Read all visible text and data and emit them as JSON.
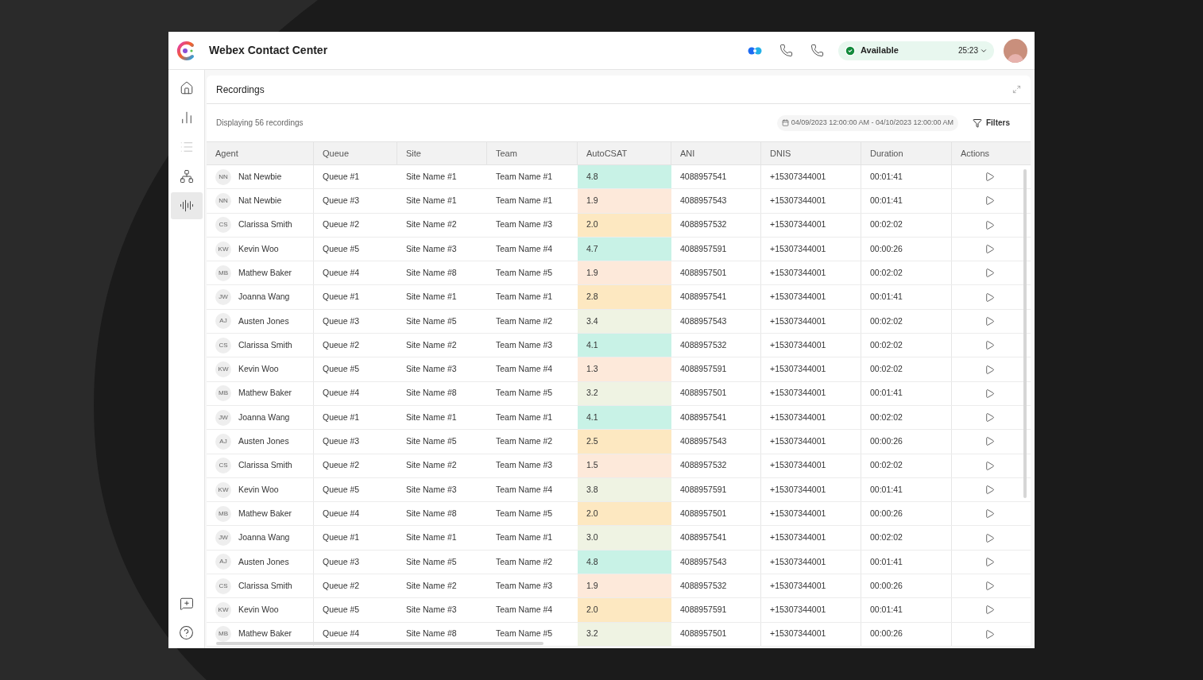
{
  "header": {
    "title": "Webex Contact Center",
    "status": {
      "label": "Available",
      "timer": "25:23"
    }
  },
  "sidebar": {
    "items": [
      {
        "selected": false,
        "disabled": false
      },
      {
        "selected": false,
        "disabled": false
      },
      {
        "selected": false,
        "disabled": true
      },
      {
        "selected": false,
        "disabled": false
      },
      {
        "selected": true,
        "disabled": false
      }
    ]
  },
  "panel": {
    "title": "Recordings",
    "summary": "Displaying 56 recordings",
    "date_range": "04/09/2023 12:00:00 AM - 04/10/2023 12:00:00 AM",
    "filters": "Filters"
  },
  "table": {
    "columns": [
      "Agent",
      "Queue",
      "Site",
      "Team",
      "AutoCSAT",
      "ANI",
      "DNIS",
      "Duration",
      "Actions"
    ],
    "rows": [
      {
        "initials": "NN",
        "agent": "Nat Newbie",
        "queue": "Queue #1",
        "site": "Site Name #1",
        "team": "Team Name #1",
        "autocsat": "4.8",
        "color": "#c8f2e6",
        "ani": "4088957541",
        "dnis": "+15307344001",
        "duration": "00:01:41"
      },
      {
        "initials": "NN",
        "agent": "Nat Newbie",
        "queue": "Queue #3",
        "site": "Site Name #1",
        "team": "Team Name #1",
        "autocsat": "1.9",
        "color": "#fde9da",
        "ani": "4088957543",
        "dnis": "+15307344001",
        "duration": "00:01:41"
      },
      {
        "initials": "CS",
        "agent": "Clarissa Smith",
        "queue": "Queue #2",
        "site": "Site Name #2",
        "team": "Team Name #3",
        "autocsat": "2.0",
        "color": "#fde8c1",
        "ani": "4088957532",
        "dnis": "+15307344001",
        "duration": "00:02:02"
      },
      {
        "initials": "KW",
        "agent": "Kevin Woo",
        "queue": "Queue #5",
        "site": "Site Name #3",
        "team": "Team Name #4",
        "autocsat": "4.7",
        "color": "#c8f2e6",
        "ani": "4088957591",
        "dnis": "+15307344001",
        "duration": "00:00:26"
      },
      {
        "initials": "MB",
        "agent": "Mathew Baker",
        "queue": "Queue #4",
        "site": "Site Name #8",
        "team": "Team Name #5",
        "autocsat": "1.9",
        "color": "#fde9da",
        "ani": "4088957501",
        "dnis": "+15307344001",
        "duration": "00:02:02"
      },
      {
        "initials": "JW",
        "agent": "Joanna Wang",
        "queue": "Queue #1",
        "site": "Site Name #1",
        "team": "Team Name #1",
        "autocsat": "2.8",
        "color": "#fde8c1",
        "ani": "4088957541",
        "dnis": "+15307344001",
        "duration": "00:01:41"
      },
      {
        "initials": "AJ",
        "agent": "Austen Jones",
        "queue": "Queue #3",
        "site": "Site Name #5",
        "team": "Team Name #2",
        "autocsat": "3.4",
        "color": "#eff3e3",
        "ani": "4088957543",
        "dnis": "+15307344001",
        "duration": "00:02:02"
      },
      {
        "initials": "CS",
        "agent": "Clarissa Smith",
        "queue": "Queue #2",
        "site": "Site Name #2",
        "team": "Team Name #3",
        "autocsat": "4.1",
        "color": "#c8f2e6",
        "ani": "4088957532",
        "dnis": "+15307344001",
        "duration": "00:02:02"
      },
      {
        "initials": "KW",
        "agent": "Kevin Woo",
        "queue": "Queue #5",
        "site": "Site Name #3",
        "team": "Team Name #4",
        "autocsat": "1.3",
        "color": "#fde9da",
        "ani": "4088957591",
        "dnis": "+15307344001",
        "duration": "00:02:02"
      },
      {
        "initials": "MB",
        "agent": "Mathew Baker",
        "queue": "Queue #4",
        "site": "Site Name #8",
        "team": "Team Name #5",
        "autocsat": "3.2",
        "color": "#eff3e3",
        "ani": "4088957501",
        "dnis": "+15307344001",
        "duration": "00:01:41"
      },
      {
        "initials": "JW",
        "agent": "Joanna Wang",
        "queue": "Queue #1",
        "site": "Site Name #1",
        "team": "Team Name #1",
        "autocsat": "4.1",
        "color": "#c8f2e6",
        "ani": "4088957541",
        "dnis": "+15307344001",
        "duration": "00:02:02"
      },
      {
        "initials": "AJ",
        "agent": "Austen Jones",
        "queue": "Queue #3",
        "site": "Site Name #5",
        "team": "Team Name #2",
        "autocsat": "2.5",
        "color": "#fde8c1",
        "ani": "4088957543",
        "dnis": "+15307344001",
        "duration": "00:00:26"
      },
      {
        "initials": "CS",
        "agent": "Clarissa Smith",
        "queue": "Queue #2",
        "site": "Site Name #2",
        "team": "Team Name #3",
        "autocsat": "1.5",
        "color": "#fde9da",
        "ani": "4088957532",
        "dnis": "+15307344001",
        "duration": "00:02:02"
      },
      {
        "initials": "KW",
        "agent": "Kevin Woo",
        "queue": "Queue #5",
        "site": "Site Name #3",
        "team": "Team Name #4",
        "autocsat": "3.8",
        "color": "#eff3e3",
        "ani": "4088957591",
        "dnis": "+15307344001",
        "duration": "00:01:41"
      },
      {
        "initials": "MB",
        "agent": "Mathew Baker",
        "queue": "Queue #4",
        "site": "Site Name #8",
        "team": "Team Name #5",
        "autocsat": "2.0",
        "color": "#fde8c1",
        "ani": "4088957501",
        "dnis": "+15307344001",
        "duration": "00:00:26"
      },
      {
        "initials": "JW",
        "agent": "Joanna Wang",
        "queue": "Queue #1",
        "site": "Site Name #1",
        "team": "Team Name #1",
        "autocsat": "3.0",
        "color": "#eff3e3",
        "ani": "4088957541",
        "dnis": "+15307344001",
        "duration": "00:02:02"
      },
      {
        "initials": "AJ",
        "agent": "Austen Jones",
        "queue": "Queue #3",
        "site": "Site Name #5",
        "team": "Team Name #2",
        "autocsat": "4.8",
        "color": "#c8f2e6",
        "ani": "4088957543",
        "dnis": "+15307344001",
        "duration": "00:01:41"
      },
      {
        "initials": "CS",
        "agent": "Clarissa Smith",
        "queue": "Queue #2",
        "site": "Site Name #2",
        "team": "Team Name #3",
        "autocsat": "1.9",
        "color": "#fde9da",
        "ani": "4088957532",
        "dnis": "+15307344001",
        "duration": "00:00:26"
      },
      {
        "initials": "KW",
        "agent": "Kevin Woo",
        "queue": "Queue #5",
        "site": "Site Name #3",
        "team": "Team Name #4",
        "autocsat": "2.0",
        "color": "#fde8c1",
        "ani": "4088957591",
        "dnis": "+15307344001",
        "duration": "00:01:41"
      },
      {
        "initials": "MB",
        "agent": "Mathew Baker",
        "queue": "Queue #4",
        "site": "Site Name #8",
        "team": "Team Name #5",
        "autocsat": "3.2",
        "color": "#eff3e3",
        "ani": "4088957501",
        "dnis": "+15307344001",
        "duration": "00:00:26"
      }
    ]
  }
}
